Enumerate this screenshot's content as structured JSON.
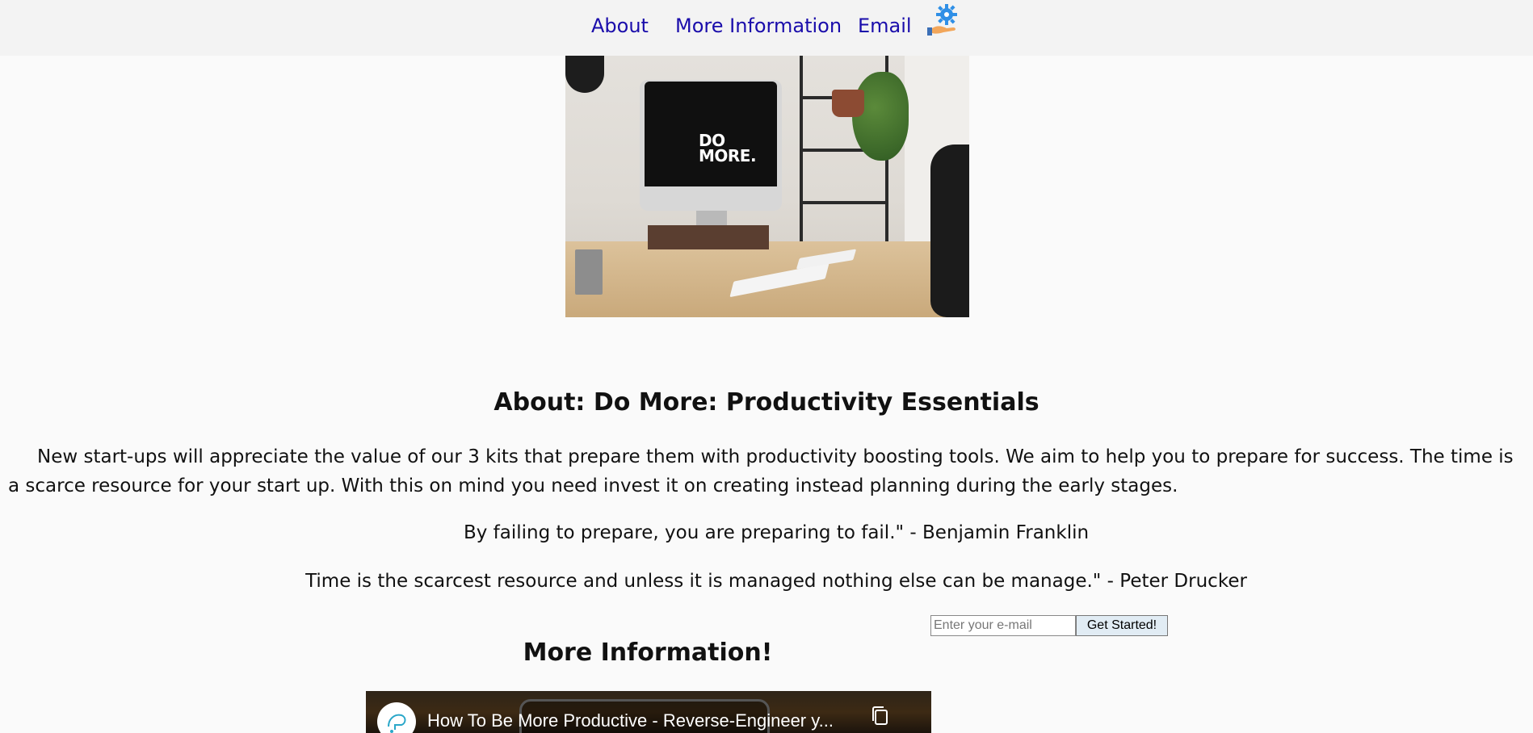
{
  "nav": {
    "about": "About",
    "more_info": "More Information",
    "email": "Email",
    "logo_icon": "hand-gear-logo-icon"
  },
  "hero": {
    "screen_text_line1": "DO",
    "screen_text_line2": "MORE."
  },
  "about": {
    "title": "About: Do More: Productivity Essentials",
    "paragraph": "New start-ups will appreciate the value of our 3 kits that prepare them with productivity boosting tools. We aim to help you to prepare for success. The time is a scarce resource for your start up. With this on mind you need invest it on creating instead planning during the early stages.",
    "quote_1": "By failing to prepare, you are preparing to fail.\" - Benjamin Franklin",
    "quote_2": "Time is the scarcest resource and unless it is managed nothing else can be manage.\" - Peter Drucker"
  },
  "form": {
    "email_placeholder": "Enter your e-mail",
    "email_value": "",
    "submit_label": "Get Started!"
  },
  "more_info": {
    "title": "More Information!"
  },
  "video": {
    "title": "How To Be More Productive - Reverse-Engineer y..."
  },
  "colors": {
    "nav_bg": "#f3f3f3",
    "link": "#1a0dab",
    "page_bg": "#fafafa",
    "button_bg": "#e1ecf4",
    "logo_gear": "#2f8fe6",
    "logo_hand": "#f2a65a"
  }
}
